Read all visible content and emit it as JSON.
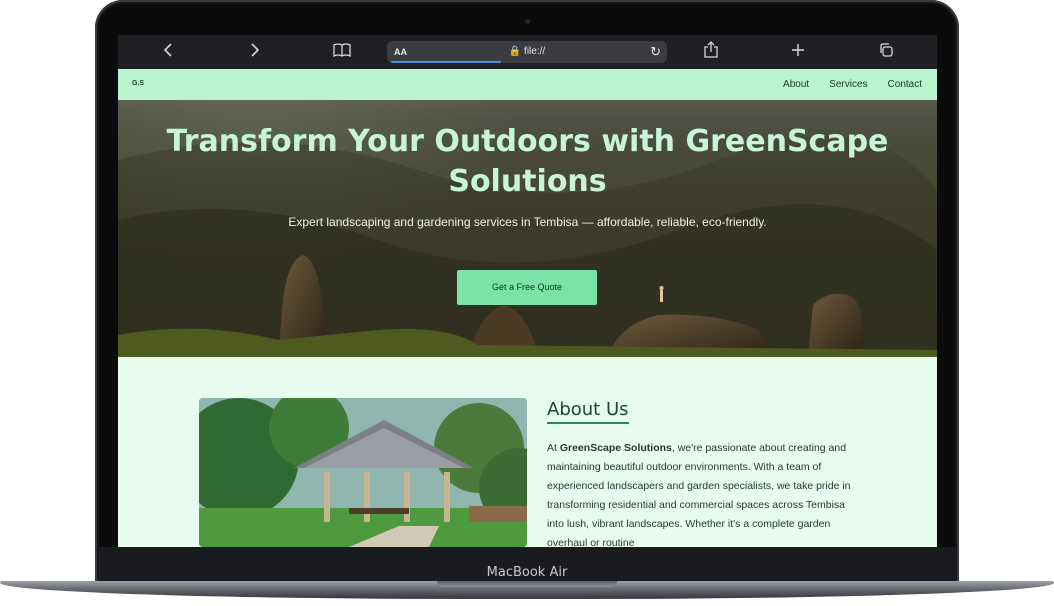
{
  "device": {
    "model_label": "MacBook Air"
  },
  "browser": {
    "address_aa": "AA",
    "url": "🔒 file://",
    "icons": [
      "chevron-left-icon",
      "chevron-right-icon",
      "book-icon",
      "reload-icon",
      "share-icon",
      "plus-icon",
      "tabs-icon"
    ]
  },
  "site": {
    "logo": "G.S",
    "nav": [
      "About",
      "Services",
      "Contact"
    ]
  },
  "hero": {
    "title": "Transform Your Outdoors with GreenScape Solutions",
    "subtitle": "Expert landscaping and gardening services in Tembisa — affordable, reliable, eco-friendly.",
    "cta": "Get a Free Quote"
  },
  "about": {
    "heading": "About Us",
    "company": "GreenScape Solutions",
    "text_before": "At ",
    "text_after": ", we're passionate about creating and maintaining beautiful outdoor environments. With a team of experienced landscapers and garden specialists, we take pride in transforming residential and commercial spaces across Tembisa into lush, vibrant landscapes. Whether it's a complete garden overhaul or routine"
  },
  "colors": {
    "nav_bg": "#b9f4cf",
    "page_bg": "#e7fcef",
    "cta_bg": "#7be3a8",
    "hero_title": "#c6f6d7",
    "accent": "#2e8a54"
  }
}
